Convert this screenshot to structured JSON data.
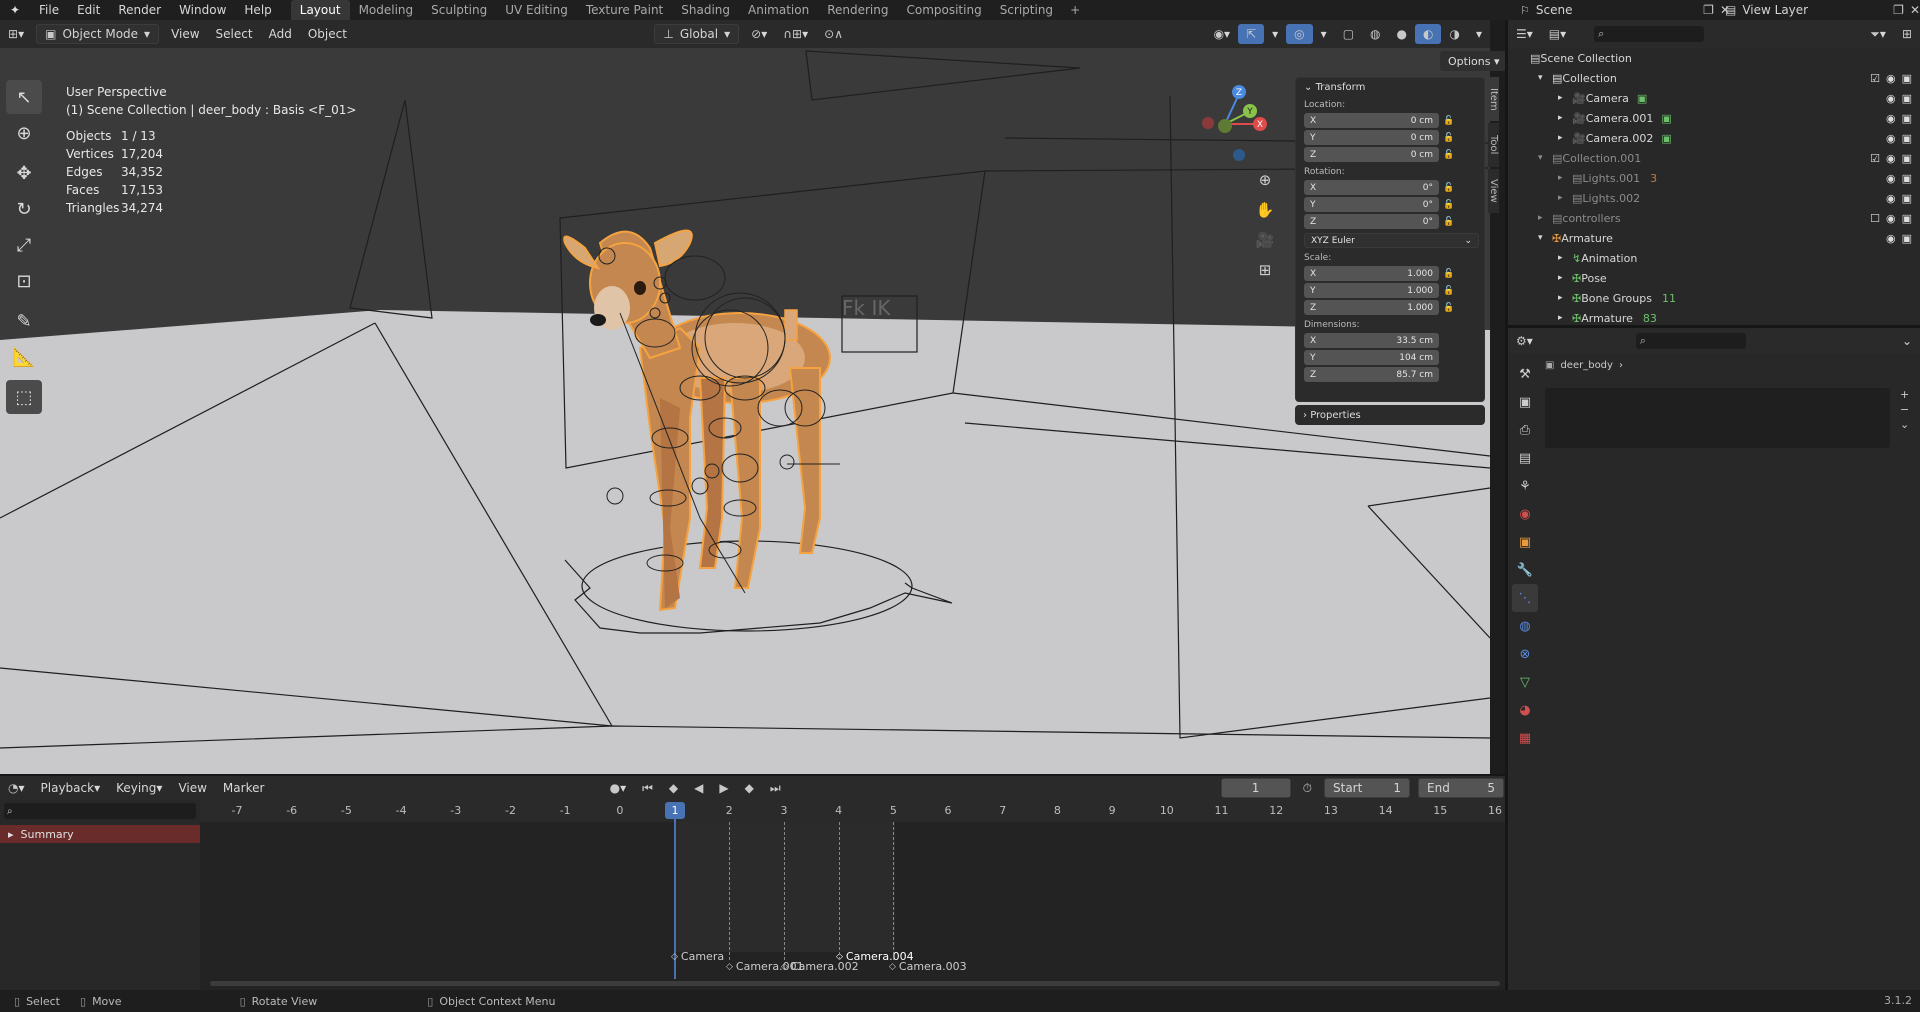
{
  "topbar": {
    "logo": "blender-logo-icon",
    "menus": [
      "File",
      "Edit",
      "Render",
      "Window",
      "Help"
    ],
    "workspaces": [
      "Layout",
      "Modeling",
      "Sculpting",
      "UV Editing",
      "Texture Paint",
      "Shading",
      "Animation",
      "Rendering",
      "Compositing",
      "Scripting"
    ],
    "active_workspace": "Layout",
    "add_workspace": "+",
    "scene": "Scene",
    "view_layer": "View Layer"
  },
  "viewport_header": {
    "mode": "Object Mode",
    "menus": [
      "View",
      "Select",
      "Add",
      "Object"
    ],
    "orientation": "Global",
    "options": "Options"
  },
  "viewport": {
    "view_name": "User Perspective",
    "context": "(1) Scene Collection | deer_body : Basis <F_01>",
    "stats": [
      {
        "label": "Objects",
        "value": "1 / 13"
      },
      {
        "label": "Vertices",
        "value": "17,204"
      },
      {
        "label": "Edges",
        "value": "34,352"
      },
      {
        "label": "Faces",
        "value": "17,153"
      },
      {
        "label": "Triangles",
        "value": "34,274"
      }
    ],
    "rig_label": "Fk   IK",
    "gizmo_axes": {
      "x": "X",
      "y": "Y",
      "z": "Z"
    }
  },
  "npanel": {
    "tabs": [
      "Item",
      "Tool",
      "View"
    ],
    "transform_title": "Transform",
    "location_label": "Location:",
    "location": [
      {
        "axis": "X",
        "value": "0 cm"
      },
      {
        "axis": "Y",
        "value": "0 cm"
      },
      {
        "axis": "Z",
        "value": "0 cm"
      }
    ],
    "rotation_label": "Rotation:",
    "rotation": [
      {
        "axis": "X",
        "value": "0°"
      },
      {
        "axis": "Y",
        "value": "0°"
      },
      {
        "axis": "Z",
        "value": "0°"
      }
    ],
    "rotation_mode": "XYZ Euler",
    "scale_label": "Scale:",
    "scale": [
      {
        "axis": "X",
        "value": "1.000"
      },
      {
        "axis": "Y",
        "value": "1.000"
      },
      {
        "axis": "Z",
        "value": "1.000"
      }
    ],
    "dimensions_label": "Dimensions:",
    "dimensions": [
      {
        "axis": "X",
        "value": "33.5 cm"
      },
      {
        "axis": "Y",
        "value": "104 cm"
      },
      {
        "axis": "Z",
        "value": "85.7 cm"
      }
    ],
    "properties_title": "Properties"
  },
  "timeline": {
    "menus": [
      "Playback",
      "Keying",
      "View",
      "Marker"
    ],
    "current_frame": "1",
    "start_label": "Start",
    "start": "1",
    "end_label": "End",
    "end": "5",
    "ticks": [
      "-7",
      "-6",
      "-5",
      "-4",
      "-3",
      "-2",
      "-1",
      "0",
      "1",
      "2",
      "3",
      "4",
      "5",
      "6",
      "7",
      "8",
      "9",
      "10",
      "11",
      "12",
      "13",
      "14",
      "15",
      "16"
    ],
    "summary": "Summary",
    "markers": [
      "Camera",
      "Camera.001",
      "Camera.002",
      "Camera.004",
      "Camera.003"
    ]
  },
  "outliner": {
    "root": "Scene Collection",
    "items": [
      {
        "label": "Collection",
        "depth": 1,
        "kind": "collection"
      },
      {
        "label": "Camera",
        "depth": 2,
        "kind": "camera"
      },
      {
        "label": "Camera.001",
        "depth": 2,
        "kind": "camera"
      },
      {
        "label": "Camera.002",
        "depth": 2,
        "kind": "camera"
      },
      {
        "label": "Collection.001",
        "depth": 1,
        "kind": "collection-dim"
      },
      {
        "label": "Lights.001",
        "depth": 2,
        "kind": "light-dim"
      },
      {
        "label": "Lights.002",
        "depth": 2,
        "kind": "light-dim"
      },
      {
        "label": "controllers",
        "depth": 1,
        "kind": "collection-dim"
      },
      {
        "label": "Armature",
        "depth": 1,
        "kind": "armature"
      },
      {
        "label": "Animation",
        "depth": 2,
        "kind": "anim"
      },
      {
        "label": "Pose",
        "depth": 2,
        "kind": "pose"
      },
      {
        "label": "Bone Groups",
        "depth": 2,
        "kind": "bonegroups"
      },
      {
        "label": "Armature",
        "depth": 2,
        "kind": "armature-data"
      }
    ],
    "badges": {
      "lights": "3",
      "bonegroups": "11",
      "armature": "83"
    }
  },
  "properties": {
    "path_object": "deer_body"
  },
  "statusbar": {
    "items": [
      "Select",
      "Move",
      "Rotate View",
      "Object Context Menu"
    ],
    "version": "3.1.2"
  },
  "colors": {
    "accent": "#4772b3",
    "selection_orange": "#f5a341",
    "axis_x": "#e04a4a",
    "axis_y": "#8ac34a",
    "axis_z": "#4a8ae0"
  }
}
